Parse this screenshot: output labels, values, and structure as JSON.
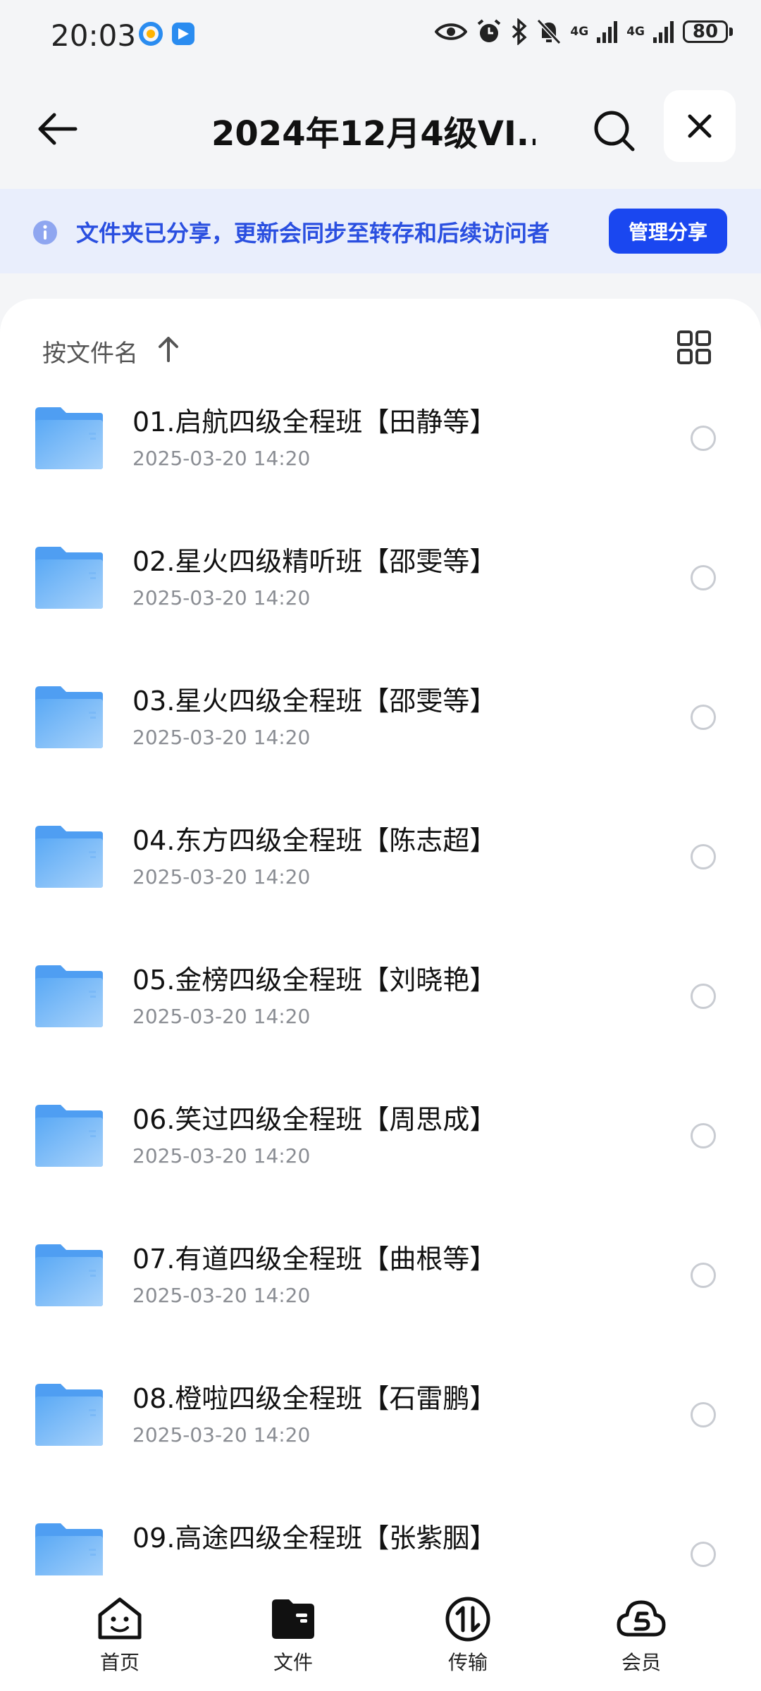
{
  "status_bar": {
    "time": "20:03",
    "network1": "4G",
    "network2": "4G",
    "battery": "80"
  },
  "header": {
    "title": "2024年12月4级VI...",
    "back_icon": "arrow-left-icon",
    "search_icon": "search-icon",
    "close_icon": "close-icon"
  },
  "banner": {
    "text": "文件夹已分享，更新会同步至转存和后续访问者",
    "button_label": "管理分享",
    "accent": "#1a47f0"
  },
  "sort": {
    "label": "按文件名"
  },
  "files": [
    {
      "name": "01.启航四级全程班【田静等】",
      "date": "2025-03-20 14:20"
    },
    {
      "name": "02.星火四级精听班【邵雯等】",
      "date": "2025-03-20 14:20"
    },
    {
      "name": "03.星火四级全程班【邵雯等】",
      "date": "2025-03-20 14:20"
    },
    {
      "name": "04.东方四级全程班【陈志超】",
      "date": "2025-03-20 14:20"
    },
    {
      "name": "05.金榜四级全程班【刘晓艳】",
      "date": "2025-03-20 14:20"
    },
    {
      "name": "06.笑过四级全程班【周思成】",
      "date": "2025-03-20 14:20"
    },
    {
      "name": "07.有道四级全程班【曲根等】",
      "date": "2025-03-20 14:20"
    },
    {
      "name": "08.橙啦四级全程班【石雷鹏】",
      "date": "2025-03-20 14:20"
    },
    {
      "name": "09.高途四级全程班【张紫胭】",
      "date": ""
    }
  ],
  "bottom_nav": {
    "items": [
      {
        "label": "首页",
        "icon": "home-face-icon"
      },
      {
        "label": "文件",
        "icon": "folder-icon"
      },
      {
        "label": "传输",
        "icon": "transfer-icon"
      },
      {
        "label": "会员",
        "icon": "cloud-vip-icon"
      }
    ]
  }
}
